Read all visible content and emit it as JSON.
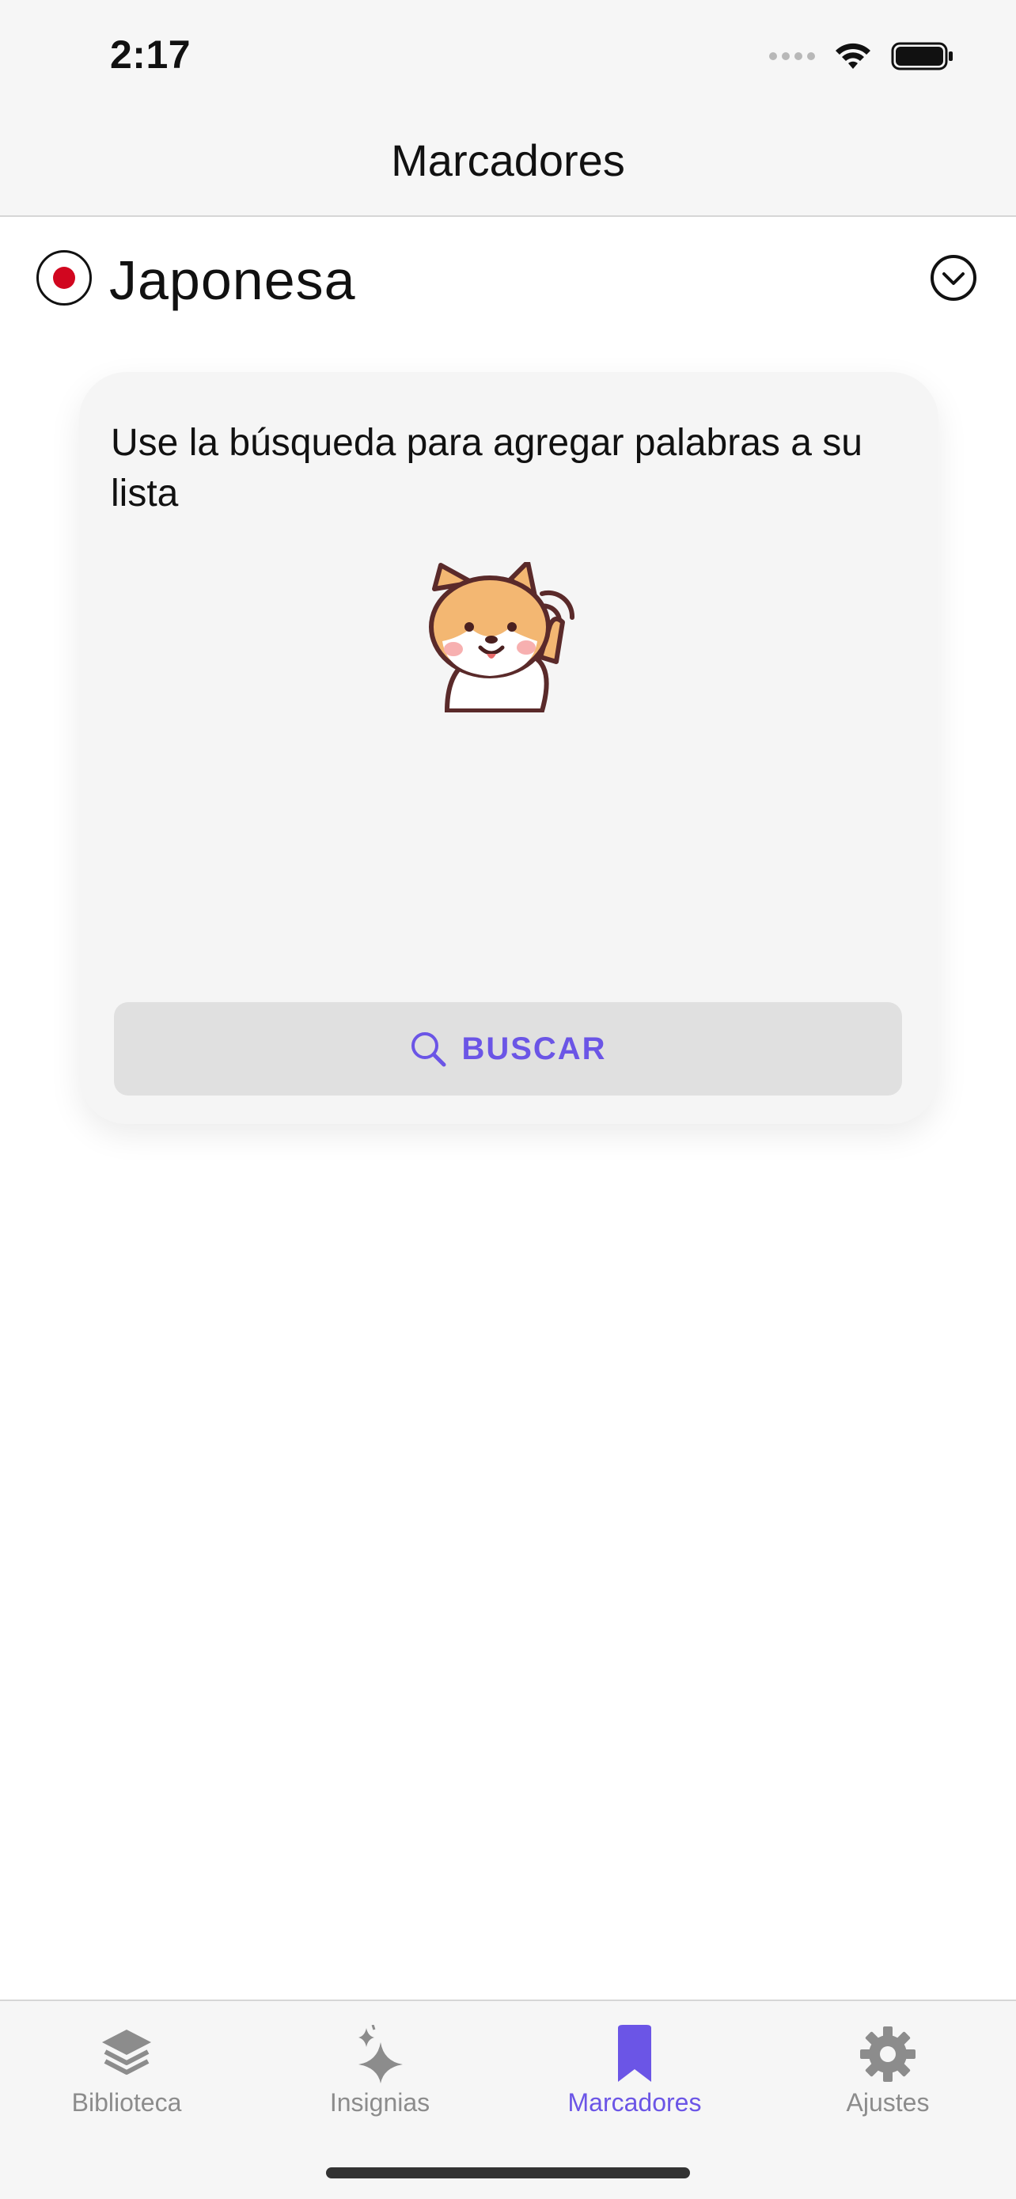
{
  "status_bar": {
    "time": "2:17"
  },
  "nav": {
    "title": "Marcadores"
  },
  "language": {
    "name": "Japonesa"
  },
  "card": {
    "message": "Use la búsqueda para agregar palabras a su lista",
    "search_label": "BUSCAR"
  },
  "tabbar": {
    "items": [
      {
        "label": "Biblioteca",
        "icon": "layers-icon"
      },
      {
        "label": "Insignias",
        "icon": "sparkles-icon"
      },
      {
        "label": "Marcadores",
        "icon": "bookmark-icon"
      },
      {
        "label": "Ajustes",
        "icon": "gear-icon"
      }
    ],
    "active_index": 2
  },
  "colors": {
    "accent": "#6b55e6",
    "flag_red": "#d1061f",
    "inactive": "#8c8c8c"
  }
}
